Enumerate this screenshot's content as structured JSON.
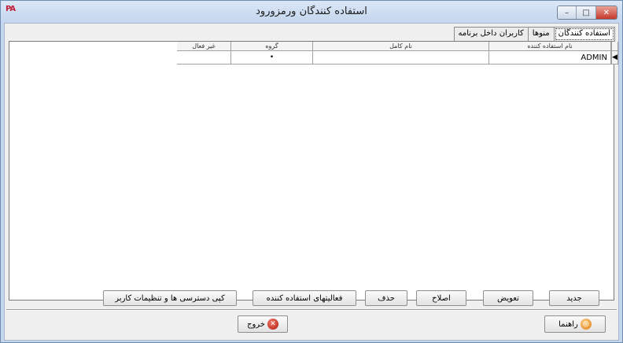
{
  "window": {
    "title": "استفاده کنندگان ورمزورود",
    "logo_text": "PA",
    "controls": {
      "minimize": "–",
      "maximize": "□",
      "close": "✕"
    }
  },
  "tabs": [
    {
      "label": "استفاده کنندگان",
      "active": true
    },
    {
      "label": "منوها",
      "active": false
    },
    {
      "label": "کاربران داخل برنامه",
      "active": false
    }
  ],
  "grid": {
    "columns": {
      "username": "نام استفاده کننده",
      "fullname": "نام کامل",
      "group": "گروه",
      "inactive": "غیر فعال"
    },
    "rows": [
      {
        "indicator": "◀",
        "username": "ADMIN",
        "fullname": "",
        "group": "•",
        "inactive": ""
      }
    ]
  },
  "buttons": {
    "new": "جدید",
    "replace": "تعویض",
    "edit": "اصلاح",
    "delete": "حذف",
    "user_activities": "فعالیتهای استفاده کننده",
    "copy_access": "کپی دسترسی ها و تنظیمات کاربر"
  },
  "footer": {
    "help": "راهنما",
    "exit": "خروج"
  },
  "icons": {
    "exit": "close-circle-icon",
    "help": "lifebuoy-icon"
  }
}
